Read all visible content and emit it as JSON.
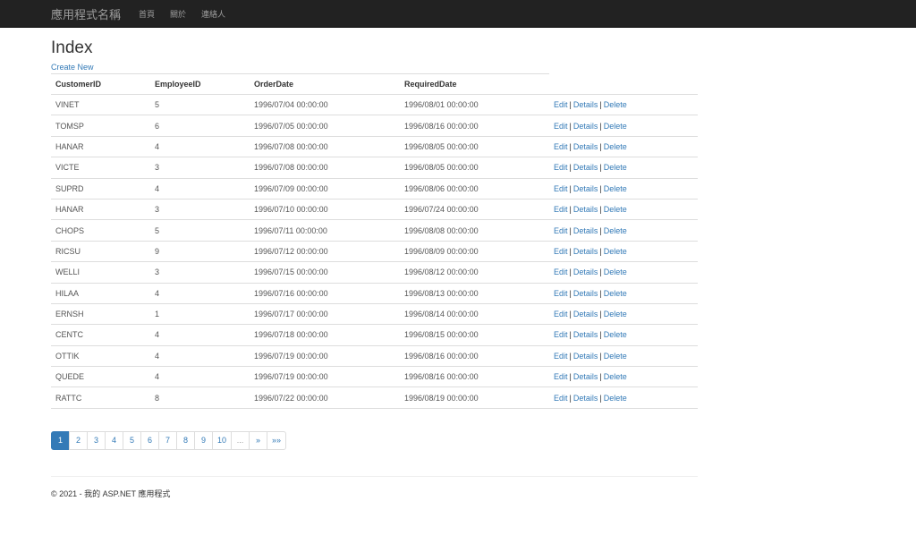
{
  "navbar": {
    "brand": "應用程式名稱",
    "links": [
      "首頁",
      "關於",
      "連絡人"
    ]
  },
  "page": {
    "title": "Index",
    "create_new": "Create New"
  },
  "table": {
    "headers": [
      "CustomerID",
      "EmployeeID",
      "OrderDate",
      "RequiredDate"
    ],
    "rows": [
      [
        "VINET",
        "5",
        "1996/07/04 00:00:00",
        "1996/08/01 00:00:00"
      ],
      [
        "TOMSP",
        "6",
        "1996/07/05 00:00:00",
        "1996/08/16 00:00:00"
      ],
      [
        "HANAR",
        "4",
        "1996/07/08 00:00:00",
        "1996/08/05 00:00:00"
      ],
      [
        "VICTE",
        "3",
        "1996/07/08 00:00:00",
        "1996/08/05 00:00:00"
      ],
      [
        "SUPRD",
        "4",
        "1996/07/09 00:00:00",
        "1996/08/06 00:00:00"
      ],
      [
        "HANAR",
        "3",
        "1996/07/10 00:00:00",
        "1996/07/24 00:00:00"
      ],
      [
        "CHOPS",
        "5",
        "1996/07/11 00:00:00",
        "1996/08/08 00:00:00"
      ],
      [
        "RICSU",
        "9",
        "1996/07/12 00:00:00",
        "1996/08/09 00:00:00"
      ],
      [
        "WELLI",
        "3",
        "1996/07/15 00:00:00",
        "1996/08/12 00:00:00"
      ],
      [
        "HILAA",
        "4",
        "1996/07/16 00:00:00",
        "1996/08/13 00:00:00"
      ],
      [
        "ERNSH",
        "1",
        "1996/07/17 00:00:00",
        "1996/08/14 00:00:00"
      ],
      [
        "CENTC",
        "4",
        "1996/07/18 00:00:00",
        "1996/08/15 00:00:00"
      ],
      [
        "OTTIK",
        "4",
        "1996/07/19 00:00:00",
        "1996/08/16 00:00:00"
      ],
      [
        "QUEDE",
        "4",
        "1996/07/19 00:00:00",
        "1996/08/16 00:00:00"
      ],
      [
        "RATTC",
        "8",
        "1996/07/22 00:00:00",
        "1996/08/19 00:00:00"
      ]
    ],
    "actions": {
      "edit": "Edit",
      "details": "Details",
      "delete": "Delete",
      "separator": "|"
    }
  },
  "pagination": {
    "items": [
      {
        "label": "1",
        "state": "active"
      },
      {
        "label": "2",
        "state": "normal"
      },
      {
        "label": "3",
        "state": "normal"
      },
      {
        "label": "4",
        "state": "normal"
      },
      {
        "label": "5",
        "state": "normal"
      },
      {
        "label": "6",
        "state": "normal"
      },
      {
        "label": "7",
        "state": "normal"
      },
      {
        "label": "8",
        "state": "normal"
      },
      {
        "label": "9",
        "state": "normal"
      },
      {
        "label": "10",
        "state": "normal"
      },
      {
        "label": "...",
        "state": "disabled"
      },
      {
        "label": "»",
        "state": "normal"
      },
      {
        "label": "»»",
        "state": "normal"
      }
    ]
  },
  "footer": {
    "text": "© 2021 - 我的 ASP.NET 應用程式"
  },
  "colors": {
    "navbar_bg": "#222222",
    "link": "#337ab7",
    "active_page": "#337ab7"
  }
}
